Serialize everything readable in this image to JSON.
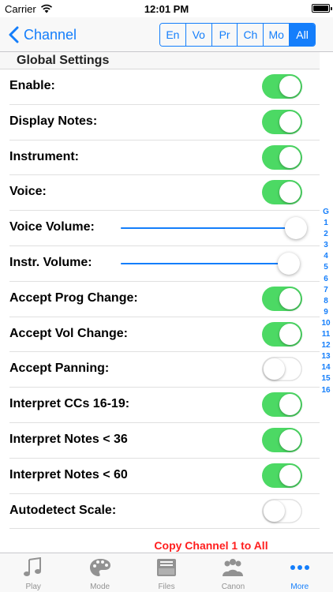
{
  "status_bar": {
    "carrier": "Carrier",
    "time": "12:01 PM"
  },
  "nav": {
    "back_label": "Channel",
    "segments": [
      {
        "label": "En",
        "active": false
      },
      {
        "label": "Vo",
        "active": false
      },
      {
        "label": "Pr",
        "active": false
      },
      {
        "label": "Ch",
        "active": false
      },
      {
        "label": "Mo",
        "active": false
      },
      {
        "label": "All",
        "active": true
      }
    ]
  },
  "section": {
    "title": "Global Settings"
  },
  "settings": [
    {
      "label": "Enable:",
      "type": "toggle",
      "on": true
    },
    {
      "label": "Display Notes:",
      "type": "toggle",
      "on": true
    },
    {
      "label": "Instrument:",
      "type": "toggle",
      "on": true
    },
    {
      "label": "Voice:",
      "type": "toggle",
      "on": true
    },
    {
      "label": "Voice Volume:",
      "type": "slider",
      "value": 1.0
    },
    {
      "label": "Instr. Volume:",
      "type": "slider",
      "value": 0.96
    },
    {
      "label": "Accept Prog Change:",
      "type": "toggle",
      "on": true
    },
    {
      "label": "Accept Vol Change:",
      "type": "toggle",
      "on": true
    },
    {
      "label": "Accept Panning:",
      "type": "toggle",
      "on": false
    },
    {
      "label": "Interpret CCs 16-19:",
      "type": "toggle",
      "on": true
    },
    {
      "label": "Interpret Notes < 36",
      "type": "toggle",
      "on": true
    },
    {
      "label": "Interpret Notes < 60",
      "type": "toggle",
      "on": true
    },
    {
      "label": "Autodetect Scale:",
      "type": "toggle",
      "on": false
    }
  ],
  "index": [
    "G",
    "1",
    "2",
    "3",
    "4",
    "5",
    "6",
    "7",
    "8",
    "9",
    "10",
    "11",
    "12",
    "13",
    "14",
    "15",
    "16"
  ],
  "copy_link": "Copy Channel 1 to All",
  "tabs": [
    {
      "label": "Play",
      "icon": "music-note-icon",
      "active": false
    },
    {
      "label": "Mode",
      "icon": "palette-icon",
      "active": false
    },
    {
      "label": "Files",
      "icon": "file-tray-icon",
      "active": false
    },
    {
      "label": "Canon",
      "icon": "group-icon",
      "active": false
    },
    {
      "label": "More",
      "icon": "more-dots-icon",
      "active": true
    }
  ],
  "colors": {
    "accent": "#147efb",
    "toggle_on": "#4cd964",
    "copy_link": "#ff1e1e"
  }
}
